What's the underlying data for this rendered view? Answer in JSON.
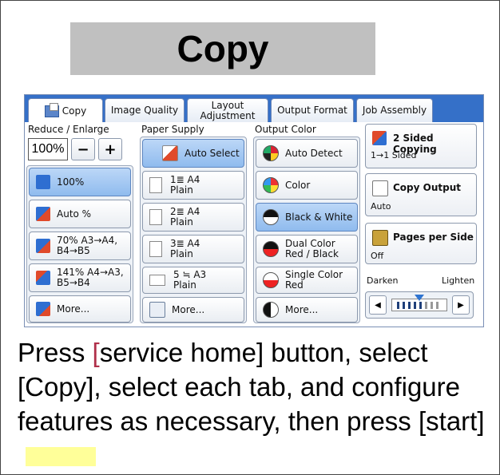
{
  "title": "Copy",
  "tabs": [
    {
      "label": "Copy",
      "active": true
    },
    {
      "label": "Image Quality"
    },
    {
      "label": "Layout\nAdjustment"
    },
    {
      "label": "Output Format"
    },
    {
      "label": "Job Assembly"
    }
  ],
  "reduce_enlarge": {
    "label": "Reduce / Enlarge",
    "value": "100%",
    "minus": "−",
    "plus": "+",
    "options": [
      "100%",
      "Auto %",
      "70% A3→A4,\nB4→B5",
      "141% A4→A3,\nB5→B4",
      "More..."
    ],
    "selected_index": 0
  },
  "paper_supply": {
    "label": "Paper Supply",
    "options": [
      "Auto Select",
      "1≣ A4\nPlain",
      "2≣ A4\nPlain",
      "3≣ A4\nPlain",
      "5 ≒ A3\nPlain",
      "More..."
    ],
    "selected_index": 0
  },
  "output_color": {
    "label": "Output Color",
    "options": [
      "Auto Detect",
      "Color",
      "Black & White",
      "Dual Color\nRed / Black",
      "Single Color\nRed",
      "More..."
    ],
    "selected_index": 2
  },
  "right_panel": {
    "two_sided": {
      "label": "2 Sided Copying",
      "value": "1→1 Sided"
    },
    "copy_output": {
      "label": "Copy Output",
      "value": "Auto"
    },
    "pages_per_side": {
      "label": "Pages per Side",
      "value": "Off"
    },
    "darken_label": "Darken",
    "lighten_label": "Lighten",
    "left_arrow": "◀",
    "right_arrow": "▶"
  },
  "instruction": {
    "part1": "Press ",
    "bracket_open": "[",
    "part2": "service home] button, select [Copy], select each tab, and configure features as necessary, then press [start]"
  },
  "colors": {
    "tab_bar": "#3570c8",
    "selected_button": "#8fbbee",
    "title_box": "#c0c0c0",
    "highlight": "#ffff99",
    "bracket": "#b0304a"
  }
}
